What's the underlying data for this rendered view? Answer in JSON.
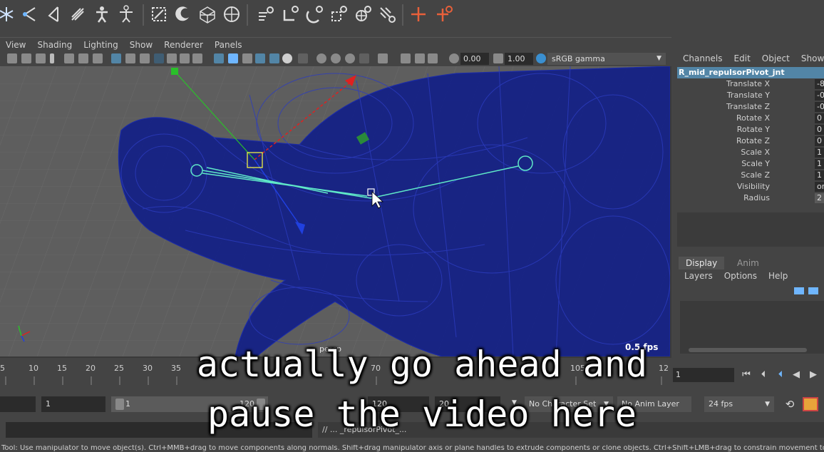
{
  "viewport": {
    "menus": [
      "View",
      "Shading",
      "Lighting",
      "Show",
      "Renderer",
      "Panels"
    ],
    "near_clip": "0.00",
    "gamma_value": "1.00",
    "color_space": "sRGB gamma",
    "camera": "persp",
    "fps": "0.5 fps"
  },
  "channel_box": {
    "menus": [
      "Channels",
      "Edit",
      "Object",
      "Show"
    ],
    "node": "R_mid_repulsorPivot_jnt",
    "attributes": [
      {
        "label": "Translate X",
        "value": "-8."
      },
      {
        "label": "Translate Y",
        "value": "-0."
      },
      {
        "label": "Translate Z",
        "value": "-0."
      },
      {
        "label": "Rotate X",
        "value": "0"
      },
      {
        "label": "Rotate Y",
        "value": "0"
      },
      {
        "label": "Rotate Z",
        "value": "0"
      },
      {
        "label": "Scale X",
        "value": "1"
      },
      {
        "label": "Scale Y",
        "value": "1"
      },
      {
        "label": "Scale Z",
        "value": "1"
      },
      {
        "label": "Visibility",
        "value": "or"
      },
      {
        "label": "Radius",
        "value": "2"
      }
    ]
  },
  "layer_editor": {
    "tabs": [
      "Display",
      "Anim"
    ],
    "menus": [
      "Layers",
      "Options",
      "Help"
    ]
  },
  "timeline": {
    "ticks": [
      "5",
      "10",
      "15",
      "20",
      "25",
      "30",
      "35",
      "70",
      "105",
      "12"
    ],
    "current_frame": "1"
  },
  "range": {
    "start": "1",
    "inner_start": "1",
    "inner_end": "120",
    "end": "120",
    "playback_end": "20",
    "character_set": "No Character Set",
    "anim_layer": "No Anim Layer",
    "fps": "24 fps"
  },
  "command": {
    "result": "// ... _repulsorPivot_..."
  },
  "help_line": "Tool: Use manipulator to move object(s). Ctrl+MMB+drag to move components along normals. Shift+drag manipulator axis or plane handles to extrude components or clone objects. Ctrl+Shift+LMB+drag to constrain movement to a connected edge. Use D or Insert",
  "subtitles": [
    "actually go ahead and",
    "pause the video here"
  ],
  "colors": {
    "wire": "#0c1a8a",
    "selected_joint": "#5fe8c8",
    "accent": "#5285a6",
    "shelf_red": "#e8603a"
  }
}
